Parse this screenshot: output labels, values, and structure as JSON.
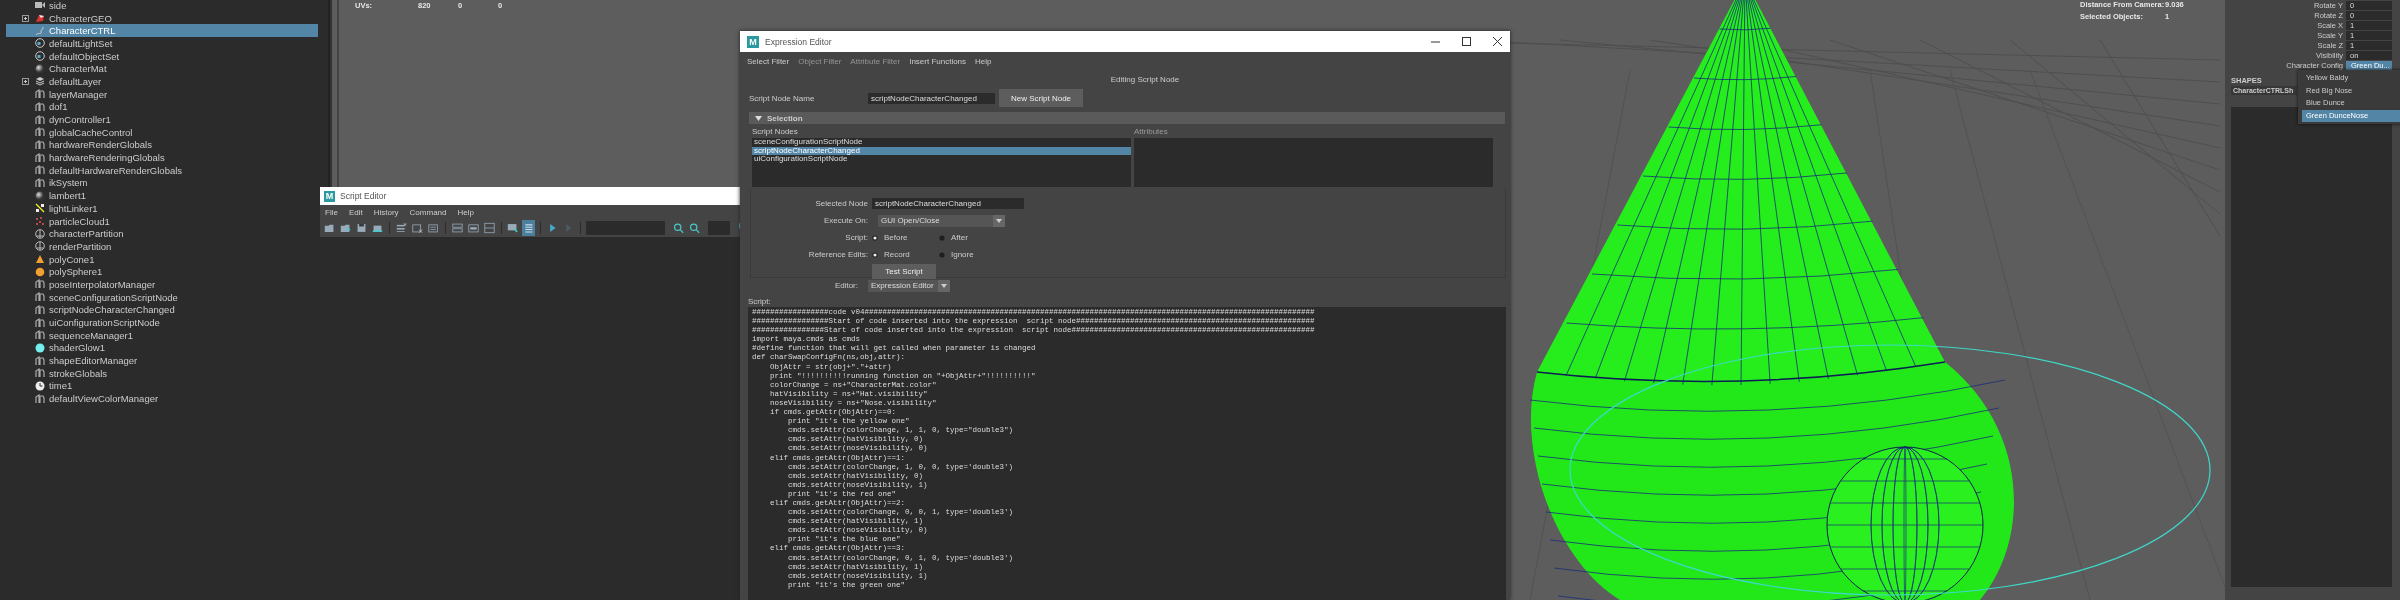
{
  "outliner": {
    "items": [
      {
        "label": "side",
        "kind": "camera",
        "expandable": false,
        "selected": false
      },
      {
        "label": "CharacterGEO",
        "kind": "mesh_group",
        "expandable": true,
        "selected": false
      },
      {
        "label": "CharacterCTRL",
        "kind": "curve",
        "expandable": false,
        "selected": true
      },
      {
        "label": "defaultLightSet",
        "kind": "set",
        "expandable": false,
        "selected": false
      },
      {
        "label": "defaultObjectSet",
        "kind": "set",
        "expandable": false,
        "selected": false
      },
      {
        "label": "CharacterMat",
        "kind": "material",
        "expandable": false,
        "selected": false
      },
      {
        "label": "defaultLayer",
        "kind": "layer",
        "expandable": true,
        "selected": false
      },
      {
        "label": "layerManager",
        "kind": "node",
        "expandable": false,
        "selected": false
      },
      {
        "label": "dof1",
        "kind": "node",
        "expandable": false,
        "selected": false
      },
      {
        "label": "dynController1",
        "kind": "node",
        "expandable": false,
        "selected": false
      },
      {
        "label": "globalCacheControl",
        "kind": "node",
        "expandable": false,
        "selected": false
      },
      {
        "label": "hardwareRenderGlobals",
        "kind": "node",
        "expandable": false,
        "selected": false
      },
      {
        "label": "hardwareRenderingGlobals",
        "kind": "node",
        "expandable": false,
        "selected": false
      },
      {
        "label": "defaultHardwareRenderGlobals",
        "kind": "node",
        "expandable": false,
        "selected": false
      },
      {
        "label": "ikSystem",
        "kind": "node",
        "expandable": false,
        "selected": false
      },
      {
        "label": "lambert1",
        "kind": "material",
        "expandable": false,
        "selected": false
      },
      {
        "label": "lightLinker1",
        "kind": "light_linker",
        "expandable": false,
        "selected": false
      },
      {
        "label": "particleCloud1",
        "kind": "particle",
        "expandable": false,
        "selected": false
      },
      {
        "label": "characterPartition",
        "kind": "partition",
        "expandable": false,
        "selected": false
      },
      {
        "label": "renderPartition",
        "kind": "partition",
        "expandable": false,
        "selected": false
      },
      {
        "label": "polyCone1",
        "kind": "cone",
        "expandable": false,
        "selected": false
      },
      {
        "label": "polySphere1",
        "kind": "sphere",
        "expandable": false,
        "selected": false
      },
      {
        "label": "poseInterpolatorManager",
        "kind": "node",
        "expandable": false,
        "selected": false
      },
      {
        "label": "sceneConfigurationScriptNode",
        "kind": "node",
        "expandable": false,
        "selected": false
      },
      {
        "label": "scriptNodeCharacterChanged",
        "kind": "node",
        "expandable": false,
        "selected": false
      },
      {
        "label": "uiConfigurationScriptNode",
        "kind": "node",
        "expandable": false,
        "selected": false
      },
      {
        "label": "sequenceManager1",
        "kind": "node",
        "expandable": false,
        "selected": false
      },
      {
        "label": "shaderGlow1",
        "kind": "glow",
        "expandable": false,
        "selected": false
      },
      {
        "label": "shapeEditorManager",
        "kind": "node",
        "expandable": false,
        "selected": false
      },
      {
        "label": "strokeGlobals",
        "kind": "node",
        "expandable": false,
        "selected": false
      },
      {
        "label": "time1",
        "kind": "time",
        "expandable": false,
        "selected": false
      },
      {
        "label": "defaultViewColorManager",
        "kind": "node",
        "expandable": false,
        "selected": false
      }
    ]
  },
  "viewport": {
    "hud_left": {
      "label": "UVs:",
      "values": [
        "820",
        "0",
        "0"
      ]
    },
    "hud_right": [
      {
        "label": "Distance From Camera:",
        "value": "9.036"
      },
      {
        "label": "Selected Objects:",
        "value": "1"
      }
    ]
  },
  "channel_box": {
    "rows": [
      {
        "label": "Rotate Y",
        "value": "0",
        "kind": "field"
      },
      {
        "label": "Rotate Z",
        "value": "0",
        "kind": "field"
      },
      {
        "label": "Scale X",
        "value": "1",
        "kind": "field"
      },
      {
        "label": "Scale Y",
        "value": "1",
        "kind": "field"
      },
      {
        "label": "Scale Z",
        "value": "1",
        "kind": "field"
      },
      {
        "label": "Visibility",
        "value": "on",
        "kind": "field"
      },
      {
        "label": "Character Config",
        "value": "Green Du...",
        "kind": "enum"
      }
    ],
    "shapes_title": "SHAPES",
    "shape_name": "CharacterCTRLSh",
    "menu": [
      {
        "label": "Yellow Baldy",
        "selected": false
      },
      {
        "label": "Red Big Nose",
        "selected": false
      },
      {
        "label": "Blue Dunce",
        "selected": false
      },
      {
        "label": "Green DunceNose",
        "selected": true
      }
    ]
  },
  "script_editor": {
    "logo": "M",
    "title": "Script Editor",
    "menu": [
      "File",
      "Edit",
      "History",
      "Command",
      "Help"
    ],
    "toolbar": [
      {
        "active": false
      },
      {
        "active": false
      },
      {
        "active": false
      },
      {
        "active": false
      },
      {
        "active": false
      },
      {
        "active": false
      },
      {
        "active": false
      },
      {
        "active": false
      },
      {
        "active": false
      },
      {
        "active": false
      },
      {
        "active": false
      },
      {
        "active": true
      },
      {
        "active": false
      },
      {
        "active": false
      },
      {
        "active": false
      },
      {
        "active": false
      },
      {
        "active": false
      }
    ]
  },
  "expression_editor": {
    "logo": "M",
    "title": "Expression Editor",
    "menu": [
      {
        "label": "Select Filter",
        "disabled": false
      },
      {
        "label": "Object Filter",
        "disabled": true
      },
      {
        "label": "Attribute Filter",
        "disabled": true
      },
      {
        "label": "Insert Functions",
        "disabled": false
      },
      {
        "label": "Help",
        "disabled": false
      }
    ],
    "heading": "Editing Script Node",
    "script_node_name": {
      "label": "Script Node Name",
      "value": "scriptNodeCharacterChanged"
    },
    "new_button": "New Script Node",
    "section": {
      "title": "Selection",
      "expanded": true
    },
    "script_nodes": {
      "label": "Script Nodes",
      "items": [
        {
          "label": "sceneConfigurationScriptNode",
          "selected": false
        },
        {
          "label": "scriptNodeCharacterChanged",
          "selected": true
        },
        {
          "label": "uiConfigurationScriptNode",
          "selected": false
        }
      ]
    },
    "attributes_label": "Attributes",
    "selected_node": {
      "label": "Selected Node",
      "value": "scriptNodeCharacterChanged"
    },
    "execute_on": {
      "label": "Execute On:",
      "value": "GUI Open/Close"
    },
    "script_radio": {
      "label": "Script:",
      "options": [
        {
          "label": "Before",
          "selected": true
        },
        {
          "label": "After",
          "selected": false
        }
      ]
    },
    "reference_edits": {
      "label": "Reference Edits:",
      "options": [
        {
          "label": "Record",
          "selected": true
        },
        {
          "label": "Ignore",
          "selected": false
        }
      ]
    },
    "test_button": "Test Script",
    "editor": {
      "label": "Editor:",
      "value": "Expression Editor"
    },
    "script_label": "Script:",
    "code_lines": [
      "#################code v04####################################################################################################",
      "#################Start of code inserted into the expression  script node#####################################################",
      "################Start of code inserted into the expression  script node######################################################",
      "import maya.cmds as cmds",
      "#define function that will get called when parameter is changed",
      "def charSwapConfigFn(ns,obj,attr):",
      "    ObjAttr = str(obj+\".\"+attr)",
      "    print \"!!!!!!!!!!running function on \"+ObjAttr+\"!!!!!!!!!!\"",
      "    colorChange = ns+\"CharacterMat.color\"",
      "    hatVisibility = ns+\"Hat.visibility\"",
      "    noseVisibility = ns+\"Nose.visibility\"",
      "    if cmds.getAttr(ObjAttr)==0:",
      "        print \"it's the yellow one\"",
      "        cmds.setAttr(colorChange, 1, 1, 0, type=\"double3\")",
      "        cmds.setAttr(hatVisibility, 0)",
      "        cmds.setAttr(noseVisibility, 0)",
      "    elif cmds.getAttr(ObjAttr)==1:",
      "        cmds.setAttr(colorChange, 1, 0, 0, type='double3')",
      "        cmds.setAttr(hatVisibility, 0)",
      "        cmds.setAttr(noseVisibility, 1)",
      "        print \"it's the red one\"",
      "    elif cmds.getAttr(ObjAttr)==2:",
      "        cmds.setAttr(colorChange, 0, 0, 1, type='double3')",
      "        cmds.setAttr(hatVisibility, 1)",
      "        cmds.setAttr(noseVisibility, 0)",
      "        print \"it's the blue one\"",
      "    elif cmds.getAttr(ObjAttr)==3:",
      "        cmds.setAttr(colorChange, 0, 1, 0, type='double3')",
      "        cmds.setAttr(hatVisibility, 1)",
      "        cmds.setAttr(noseVisibility, 1)",
      "        print \"it's the green one\""
    ]
  }
}
